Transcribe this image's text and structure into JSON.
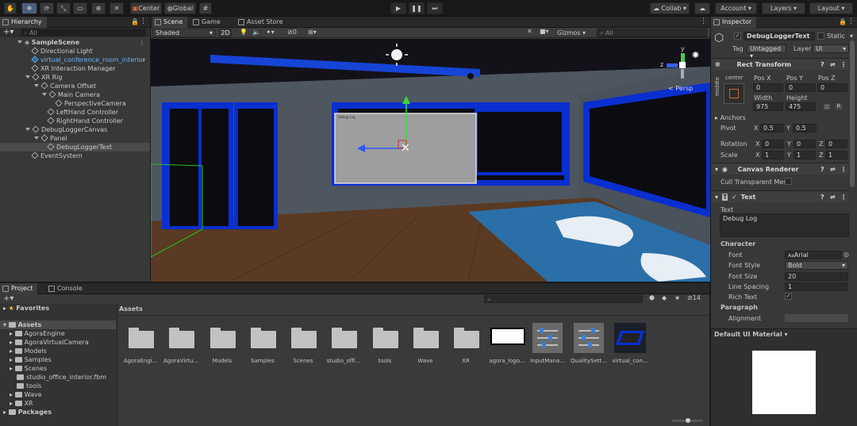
{
  "toolbar": {
    "center_label": "Center",
    "global_label": "Global",
    "collab_label": "Collab",
    "account_label": "Account",
    "layers_label": "Layers",
    "layout_label": "Layout"
  },
  "hierarchy": {
    "tab": "Hierarchy",
    "search_placeholder": "All",
    "scene": "SampleScene",
    "items": [
      "Directional Light",
      "virtual_conference_room_interior",
      "XR Interaction Manager",
      "XR Rig",
      "Camera Offset",
      "Main Camera",
      "PerspectiveCamera",
      "LeftHand Controller",
      "RightHand Controller",
      "DebugLoggerCanvas",
      "Panel",
      "DebugLoggerText",
      "EventSystem"
    ]
  },
  "scene_view": {
    "tabs": [
      "Scene",
      "Game",
      "Asset Store"
    ],
    "shading": "Shaded",
    "mode_2d": "2D",
    "hidden_count": "0",
    "gizmos": "Gizmos",
    "search_placeholder": "All",
    "persp": "< Persp",
    "axis_x": "x",
    "axis_y": "y",
    "axis_z": "z",
    "panel_text": "Debug Log"
  },
  "inspector": {
    "tab": "Inspector",
    "object_name": "DebugLoggerText",
    "static_label": "Static",
    "tag_label": "Tag",
    "tag_value": "Untagged",
    "layer_label": "Layer",
    "layer_value": "UI",
    "rect_transform": "Rect Transform",
    "anchor_top": "center",
    "anchor_side": "middle",
    "pos_x_label": "Pos X",
    "pos_y_label": "Pos Y",
    "pos_z_label": "Pos Z",
    "pos_x": "0",
    "pos_y": "0",
    "pos_z": "0",
    "width_label": "Width",
    "height_label": "Height",
    "width": "975",
    "height": "475",
    "anchors_label": "Anchors",
    "pivot_label": "Pivot",
    "pivot_x": "0.5",
    "pivot_y": "0.5",
    "rotation_label": "Rotation",
    "rot_x": "0",
    "rot_y": "0",
    "rot_z": "0",
    "scale_label": "Scale",
    "scale_x": "1",
    "scale_y": "1",
    "scale_z": "1",
    "canvas_renderer": "Canvas Renderer",
    "cull_label": "Cull Transparent Mes",
    "text_component": "Text",
    "text_label": "Text",
    "text_value": "Debug Log",
    "character_label": "Character",
    "font_label": "Font",
    "font_value": "Arial",
    "font_style_label": "Font Style",
    "font_style_value": "Bold",
    "font_size_label": "Font Size",
    "font_size_value": "20",
    "line_spacing_label": "Line Spacing",
    "line_spacing_value": "1",
    "rich_text_label": "Rich Text",
    "paragraph_label": "Paragraph",
    "alignment_label": "Alignment",
    "material_label": "Default UI Material"
  },
  "project": {
    "tabs": [
      "Project",
      "Console"
    ],
    "favorites": "Favorites",
    "assets_root": "Assets",
    "tree": [
      "AgoraEngine",
      "AgoraVirtualCamera",
      "Models",
      "Samples",
      "Scenes",
      "studio_office_interior.fbm",
      "tools",
      "Wave",
      "XR"
    ],
    "packages": "Packages",
    "breadcrumb": "Assets",
    "hidden_count": "14",
    "assets": [
      {
        "label": "AgoraEngi...",
        "kind": "folder"
      },
      {
        "label": "AgoraVirtu...",
        "kind": "folder"
      },
      {
        "label": "Models",
        "kind": "folder"
      },
      {
        "label": "Samples",
        "kind": "folder"
      },
      {
        "label": "Scenes",
        "kind": "folder"
      },
      {
        "label": "studio_offi...",
        "kind": "folder"
      },
      {
        "label": "tools",
        "kind": "folder"
      },
      {
        "label": "Wave",
        "kind": "folder"
      },
      {
        "label": "XR",
        "kind": "folder"
      },
      {
        "label": "agora_logo...",
        "kind": "image"
      },
      {
        "label": "InputMana...",
        "kind": "asset"
      },
      {
        "label": "QualitySett...",
        "kind": "asset"
      },
      {
        "label": "virtual_con...",
        "kind": "model"
      }
    ]
  },
  "colors": {
    "accent_blue": "#3a79c9",
    "wall_blue": "#0a2fd0",
    "selection": "#4a4a4a"
  }
}
